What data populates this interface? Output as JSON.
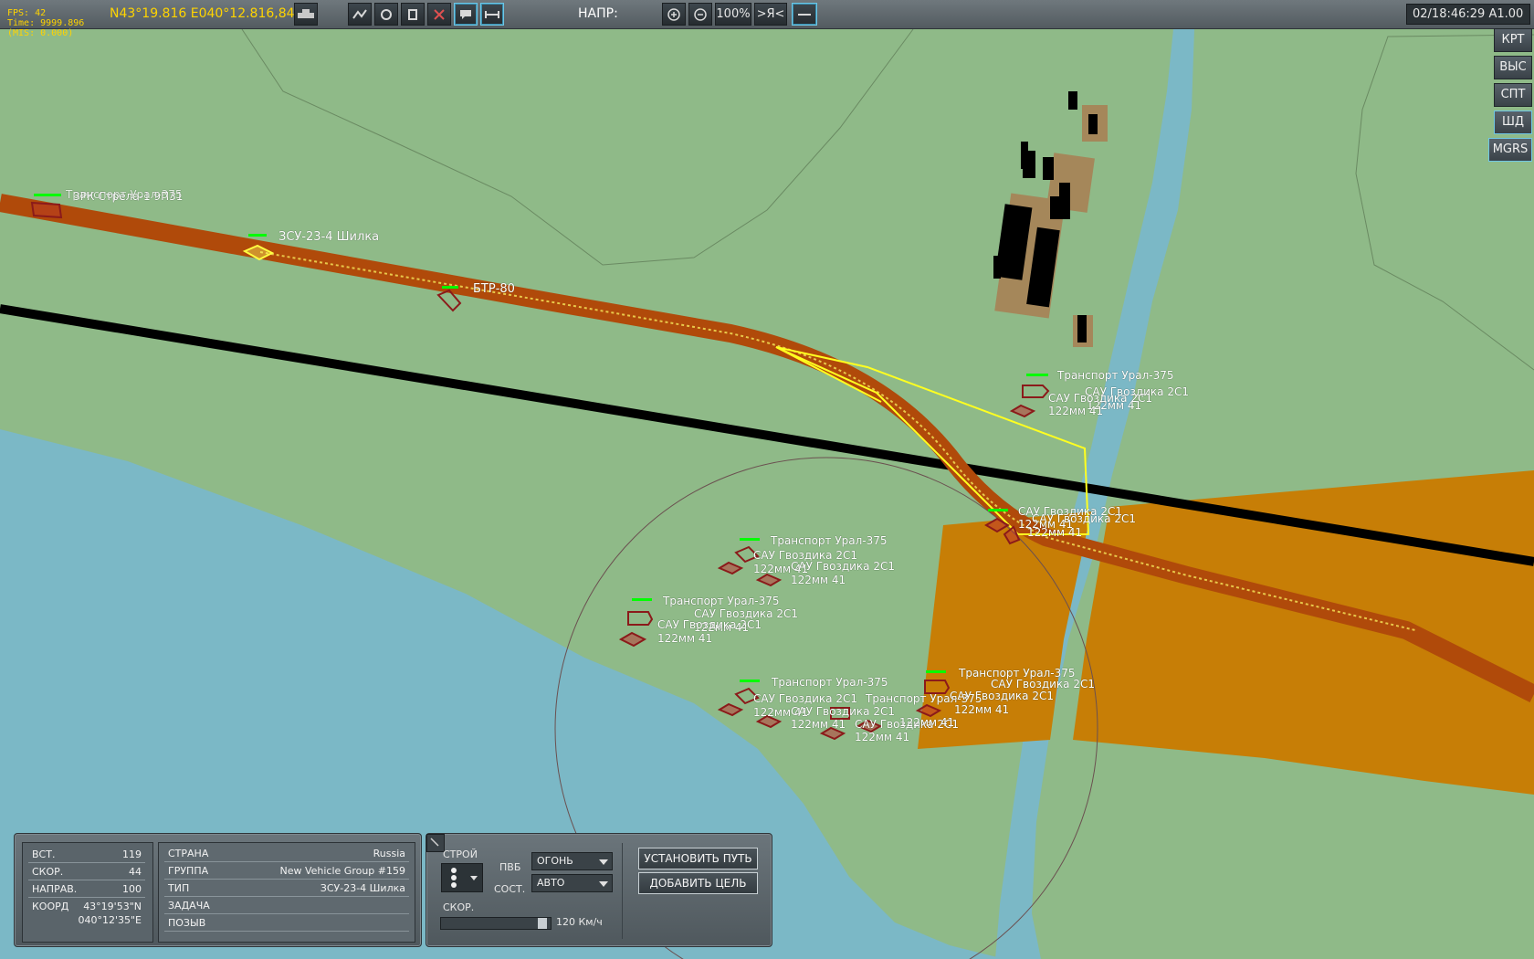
{
  "topbar": {
    "debug_line1": "FPS: 42",
    "debug_line2": "Time: 9999.896",
    "debug_line3": "(MIS: 0.000)",
    "coords": "N43°19.816 E040°12.816,84m",
    "direction_label": "НАПР:",
    "zoom": "100%",
    "center_button": ">Я<",
    "clock": "02/18:46:29 A1.00",
    "tools": [
      "route-icon",
      "satellite-icon",
      "info-icon",
      "delete-icon",
      "comment-icon",
      "ruler-icon"
    ]
  },
  "right_buttons": [
    "КРТ",
    "ВЫС",
    "СПТ",
    "ШД",
    "MGRS"
  ],
  "units": [
    {
      "name": "ЗРК Стрела-1 9П31",
      "kind": "overlay_a"
    },
    {
      "name": "Транспорт Урал-375",
      "kind": "overlay_b"
    },
    {
      "name": "ЗСУ-23-4 Шилка"
    },
    {
      "name": "БТР-80"
    },
    {
      "name": "Транспорт Урал-375"
    },
    {
      "name": "САУ Гвоздика 2С1"
    },
    {
      "name": "122мм 41"
    },
    {
      "name": "САУ Гвоздика 2С1"
    },
    {
      "name": "122мм 41"
    },
    {
      "name": "САУ Гвоздика 2С1"
    },
    {
      "name": "122мм 41"
    },
    {
      "name": "САУ Гвоздика 2С1"
    },
    {
      "name": "122мм 41"
    },
    {
      "name": "Транспорт Урал-375"
    },
    {
      "name": "САУ Гвоздика 2С1"
    },
    {
      "name": "122мм 41"
    },
    {
      "name": "САУ Гвоздика 2С1"
    },
    {
      "name": "122мм 41"
    },
    {
      "name": "Транспорт Урал-375"
    },
    {
      "name": "САУ Гвоздика 2С1"
    },
    {
      "name": "122мм 41"
    },
    {
      "name": "САУ Гвоздика 2С1"
    },
    {
      "name": "122мм 41"
    },
    {
      "name": "Транспорт Урал-375"
    },
    {
      "name": "САУ Гвоздика 2С1"
    },
    {
      "name": "122мм 41"
    },
    {
      "name": "Транспорт Урал-375"
    },
    {
      "name": "САУ Гвоздика 2С1"
    },
    {
      "name": "122мм 41"
    },
    {
      "name": "САУ Гвоздика 2С1"
    },
    {
      "name": "122мм 41"
    },
    {
      "name": "Транспорт Урал-375"
    },
    {
      "name": "САУ Гвоздика 2С1"
    },
    {
      "name": "122мм 41"
    },
    {
      "name": "САУ Гвоздика 2С1"
    },
    {
      "name": "122мм 41"
    }
  ],
  "info_panel": {
    "alt_label": "ВСТ.",
    "alt_value": "119",
    "speed_label": "СКОР.",
    "speed_value": "44",
    "heading_label": "НАПРАВ.",
    "heading_value": "100",
    "coord_label": "КООРД",
    "coord_lat": "43°19'53\"N",
    "coord_lon": "040°12'35\"E",
    "country_label": "СТРАНА",
    "country_value": "Russia",
    "group_label": "ГРУППА",
    "group_value": "New Vehicle Group #159",
    "type_label": "ТИП",
    "type_value": "ЗСУ-23-4 Шилка",
    "task_label": "ЗАДАЧА",
    "task_value": "",
    "callsign_label": "ПОЗЫВ",
    "callsign_value": ""
  },
  "orders_panel": {
    "formation_label": "СТРОЙ",
    "roe_label": "ПВБ",
    "roe_value": "ОГОНЬ",
    "alarm_label": "СОСТ.",
    "alarm_value": "АВТО",
    "speed_label": "СКОР.",
    "speed_value": "120 Км/ч",
    "speed_fraction": 0.96,
    "set_path_button": "УСТАНОВИТЬ ПУТЬ",
    "add_target_button": "ДОБАВИТЬ ЦЕЛЬ"
  },
  "colors": {
    "terrain": "#8fba88",
    "water": "#7bb8c6",
    "road": "#b04a0a",
    "railway": "#000000",
    "zone": "#c77e06",
    "route": "#ffff20",
    "unit_marker": "#8b1a1a",
    "health_bar": "#00ff00"
  }
}
